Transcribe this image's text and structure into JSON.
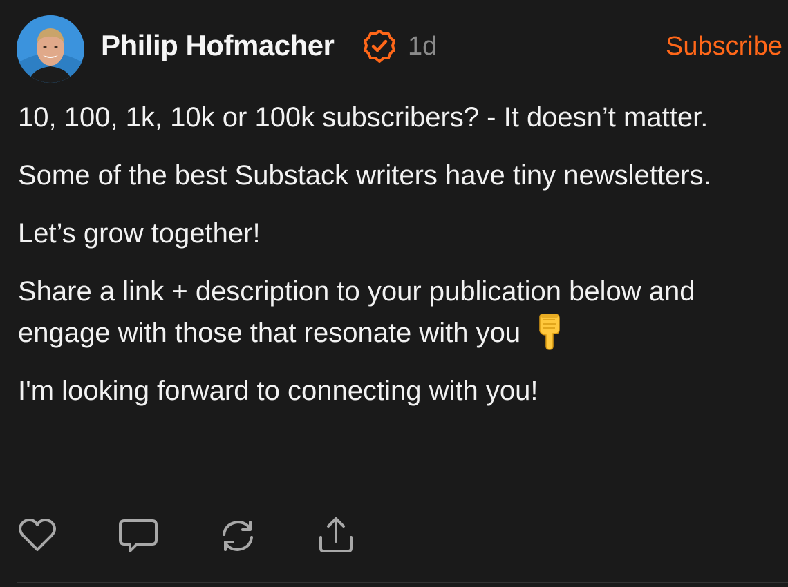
{
  "author": {
    "name": "Philip Hofmacher",
    "verified_icon": "verified-badge-icon",
    "timestamp": "1d"
  },
  "subscribe_label": "Subscribe",
  "paragraphs": [
    "10, 100, 1k, 10k or 100k subscribers? - It doesn’t matter.",
    "Some of the best Substack writers have tiny newsletters.",
    "Let’s grow together!",
    "Share a link + description to your publication below and engage with those that resonate with you",
    "I'm looking forward to connecting with you!"
  ],
  "emoji": "pointing-down-hand",
  "actions": [
    "heart-icon",
    "comment-icon",
    "restack-icon",
    "share-icon"
  ],
  "colors": {
    "background": "#1a1a1a",
    "accent": "#ff6719",
    "text": "#f2f2f2",
    "muted": "#8a8a8a",
    "icon": "#a8a8a8"
  }
}
